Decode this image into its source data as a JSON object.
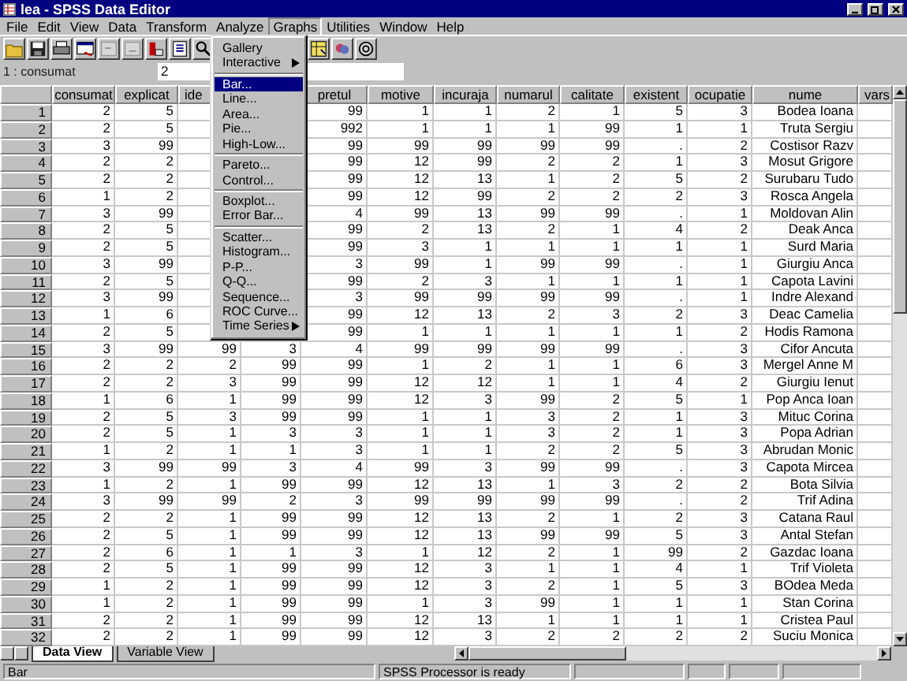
{
  "window": {
    "title": "lea - SPSS Data Editor"
  },
  "menubar": [
    {
      "label": "File",
      "selected": false
    },
    {
      "label": "Edit",
      "selected": false
    },
    {
      "label": "View",
      "selected": false
    },
    {
      "label": "Data",
      "selected": false
    },
    {
      "label": "Transform",
      "selected": false
    },
    {
      "label": "Analyze",
      "selected": false
    },
    {
      "label": "Graphs",
      "selected": true
    },
    {
      "label": "Utilities",
      "selected": false
    },
    {
      "label": "Window",
      "selected": false
    },
    {
      "label": "Help",
      "selected": false
    }
  ],
  "graphs_menu": {
    "groups": [
      {
        "items": [
          {
            "label": "Gallery",
            "selected": false,
            "submenu": false
          },
          {
            "label": "Interactive",
            "selected": false,
            "submenu": true
          }
        ]
      },
      {
        "items": [
          {
            "label": "Bar...",
            "selected": true,
            "submenu": false
          },
          {
            "label": "Line...",
            "selected": false,
            "submenu": false
          },
          {
            "label": "Area...",
            "selected": false,
            "submenu": false
          },
          {
            "label": "Pie...",
            "selected": false,
            "submenu": false
          },
          {
            "label": "High-Low...",
            "selected": false,
            "submenu": false
          }
        ]
      },
      {
        "items": [
          {
            "label": "Pareto...",
            "selected": false,
            "submenu": false
          },
          {
            "label": "Control...",
            "selected": false,
            "submenu": false
          }
        ]
      },
      {
        "items": [
          {
            "label": "Boxplot...",
            "selected": false,
            "submenu": false
          },
          {
            "label": "Error Bar...",
            "selected": false,
            "submenu": false
          }
        ]
      },
      {
        "items": [
          {
            "label": "Scatter...",
            "selected": false,
            "submenu": false
          },
          {
            "label": "Histogram...",
            "selected": false,
            "submenu": false
          },
          {
            "label": "P-P...",
            "selected": false,
            "submenu": false
          },
          {
            "label": "Q-Q...",
            "selected": false,
            "submenu": false
          },
          {
            "label": "Sequence...",
            "selected": false,
            "submenu": false
          },
          {
            "label": "ROC Curve...",
            "selected": false,
            "submenu": false
          },
          {
            "label": "Time Series",
            "selected": false,
            "submenu": true
          }
        ]
      }
    ]
  },
  "cell_editor": {
    "reference": "1 : consumat",
    "value": "2"
  },
  "table": {
    "columns": [
      {
        "label": "consumat",
        "clipped": false
      },
      {
        "label": "explicat",
        "clipped": false
      },
      {
        "label": "ide",
        "clipped": true
      },
      null,
      {
        "label": "pretul",
        "clipped": false
      },
      {
        "label": "motive",
        "clipped": false
      },
      {
        "label": "incuraja",
        "clipped": false
      },
      {
        "label": "numarul",
        "clipped": false
      },
      {
        "label": "calitate",
        "clipped": false
      },
      {
        "label": "existent",
        "clipped": false
      },
      {
        "label": "ocupatie",
        "clipped": false
      },
      {
        "label": "nume",
        "clipped": false
      },
      {
        "label": "vars",
        "clipped": true
      }
    ],
    "rows": [
      {
        "number": "1",
        "cells": [
          "2",
          "5",
          null,
          null,
          "99",
          "1",
          "1",
          "2",
          "1",
          "5",
          "3",
          "Bodea Ioana",
          null
        ]
      },
      {
        "number": "2",
        "cells": [
          "2",
          "5",
          null,
          null,
          "992",
          "1",
          "1",
          "1",
          "99",
          "1",
          "1",
          "Truta Sergiu",
          null
        ]
      },
      {
        "number": "3",
        "cells": [
          "3",
          "99",
          null,
          null,
          "99",
          "99",
          "99",
          "99",
          "99",
          ".",
          "2",
          "Costisor Razv",
          null
        ]
      },
      {
        "number": "4",
        "cells": [
          "2",
          "2",
          null,
          null,
          "99",
          "12",
          "99",
          "2",
          "2",
          "1",
          "3",
          "Mosut Grigore",
          null
        ]
      },
      {
        "number": "5",
        "cells": [
          "2",
          "2",
          null,
          null,
          "99",
          "12",
          "13",
          "1",
          "2",
          "5",
          "2",
          "Surubaru Tudo",
          null
        ]
      },
      {
        "number": "6",
        "cells": [
          "1",
          "2",
          null,
          null,
          "99",
          "12",
          "99",
          "2",
          "2",
          "2",
          "3",
          "Rosca Angela",
          null
        ]
      },
      {
        "number": "7",
        "cells": [
          "3",
          "99",
          null,
          null,
          "4",
          "99",
          "13",
          "99",
          "99",
          ".",
          "1",
          "Moldovan Alin",
          null
        ]
      },
      {
        "number": "8",
        "cells": [
          "2",
          "5",
          null,
          null,
          "99",
          "2",
          "13",
          "2",
          "1",
          "4",
          "2",
          "Deak Anca",
          null
        ]
      },
      {
        "number": "9",
        "cells": [
          "2",
          "5",
          null,
          null,
          "99",
          "3",
          "1",
          "1",
          "1",
          "1",
          "1",
          "Surd Maria",
          null
        ]
      },
      {
        "number": "10",
        "cells": [
          "3",
          "99",
          null,
          null,
          "3",
          "99",
          "1",
          "99",
          "99",
          ".",
          "1",
          "Giurgiu Anca",
          null
        ]
      },
      {
        "number": "11",
        "cells": [
          "2",
          "5",
          null,
          null,
          "99",
          "2",
          "3",
          "1",
          "1",
          "1",
          "1",
          "Capota Lavini",
          null
        ]
      },
      {
        "number": "12",
        "cells": [
          "3",
          "99",
          null,
          null,
          "3",
          "99",
          "99",
          "99",
          "99",
          ".",
          "1",
          "Indre Alexand",
          null
        ]
      },
      {
        "number": "13",
        "cells": [
          "1",
          "6",
          null,
          null,
          "99",
          "12",
          "13",
          "2",
          "3",
          "2",
          "3",
          "Deac Camelia",
          null
        ]
      },
      {
        "number": "14",
        "cells": [
          "2",
          "5",
          null,
          null,
          "99",
          "1",
          "1",
          "1",
          "1",
          "1",
          "2",
          "Hodis Ramona",
          null
        ]
      },
      {
        "number": "15",
        "cells": [
          "3",
          "99",
          "99",
          "3",
          "4",
          "99",
          "99",
          "99",
          "99",
          ".",
          "3",
          "Cifor Ancuta",
          null
        ]
      },
      {
        "number": "16",
        "cells": [
          "2",
          "2",
          "2",
          "99",
          "99",
          "1",
          "2",
          "1",
          "1",
          "6",
          "3",
          "Mergel Anne M",
          null
        ]
      },
      {
        "number": "17",
        "cells": [
          "2",
          "2",
          "3",
          "99",
          "99",
          "12",
          "12",
          "1",
          "1",
          "4",
          "2",
          "Giurgiu Ienut",
          null
        ]
      },
      {
        "number": "18",
        "cells": [
          "1",
          "6",
          "1",
          "99",
          "99",
          "12",
          "3",
          "99",
          "2",
          "5",
          "1",
          "Pop Anca Ioan",
          null
        ]
      },
      {
        "number": "19",
        "cells": [
          "2",
          "5",
          "3",
          "99",
          "99",
          "1",
          "1",
          "3",
          "2",
          "1",
          "3",
          "Mituc Corina",
          null
        ]
      },
      {
        "number": "20",
        "cells": [
          "2",
          "5",
          "1",
          "3",
          "3",
          "1",
          "1",
          "3",
          "2",
          "1",
          "3",
          "Popa Adrian",
          null
        ]
      },
      {
        "number": "21",
        "cells": [
          "1",
          "2",
          "1",
          "1",
          "3",
          "1",
          "1",
          "2",
          "2",
          "5",
          "3",
          "Abrudan Monic",
          null
        ]
      },
      {
        "number": "22",
        "cells": [
          "3",
          "99",
          "99",
          "3",
          "4",
          "99",
          "3",
          "99",
          "99",
          ".",
          "3",
          "Capota Mircea",
          null
        ]
      },
      {
        "number": "23",
        "cells": [
          "1",
          "2",
          "1",
          "99",
          "99",
          "12",
          "13",
          "1",
          "3",
          "2",
          "2",
          "Bota Silvia",
          null
        ]
      },
      {
        "number": "24",
        "cells": [
          "3",
          "99",
          "99",
          "2",
          "3",
          "99",
          "99",
          "99",
          "99",
          ".",
          "2",
          "Trif Adina",
          null
        ]
      },
      {
        "number": "25",
        "cells": [
          "2",
          "2",
          "1",
          "99",
          "99",
          "12",
          "13",
          "2",
          "1",
          "2",
          "3",
          "Catana Raul",
          null
        ]
      },
      {
        "number": "26",
        "cells": [
          "2",
          "5",
          "1",
          "99",
          "99",
          "12",
          "13",
          "99",
          "99",
          "5",
          "3",
          "Antal Stefan",
          null
        ]
      },
      {
        "number": "27",
        "cells": [
          "2",
          "6",
          "1",
          "1",
          "3",
          "1",
          "12",
          "2",
          "1",
          "99",
          "2",
          "Gazdac Ioana",
          null
        ]
      },
      {
        "number": "28",
        "cells": [
          "2",
          "5",
          "1",
          "99",
          "99",
          "12",
          "3",
          "1",
          "1",
          "4",
          "1",
          "Trif Violeta",
          null
        ]
      },
      {
        "number": "29",
        "cells": [
          "1",
          "2",
          "1",
          "99",
          "99",
          "12",
          "3",
          "2",
          "1",
          "5",
          "3",
          "BOdea Meda",
          null
        ]
      },
      {
        "number": "30",
        "cells": [
          "1",
          "2",
          "1",
          "99",
          "99",
          "1",
          "3",
          "99",
          "1",
          "1",
          "1",
          "Stan Corina",
          null
        ]
      },
      {
        "number": "31",
        "cells": [
          "2",
          "2",
          "1",
          "99",
          "99",
          "12",
          "13",
          "1",
          "1",
          "1",
          "1",
          "Cristea Paul",
          null
        ]
      },
      {
        "number": "32",
        "cells": [
          "2",
          "2",
          "1",
          "99",
          "99",
          "12",
          "3",
          "2",
          "2",
          "2",
          "2",
          "Suciu Monica",
          null
        ]
      }
    ]
  },
  "tabs": [
    {
      "label": "Data View",
      "selected": true
    },
    {
      "label": "Variable View",
      "selected": false
    }
  ],
  "status_bar": {
    "message": "Bar",
    "processor": "SPSS Processor is ready"
  }
}
